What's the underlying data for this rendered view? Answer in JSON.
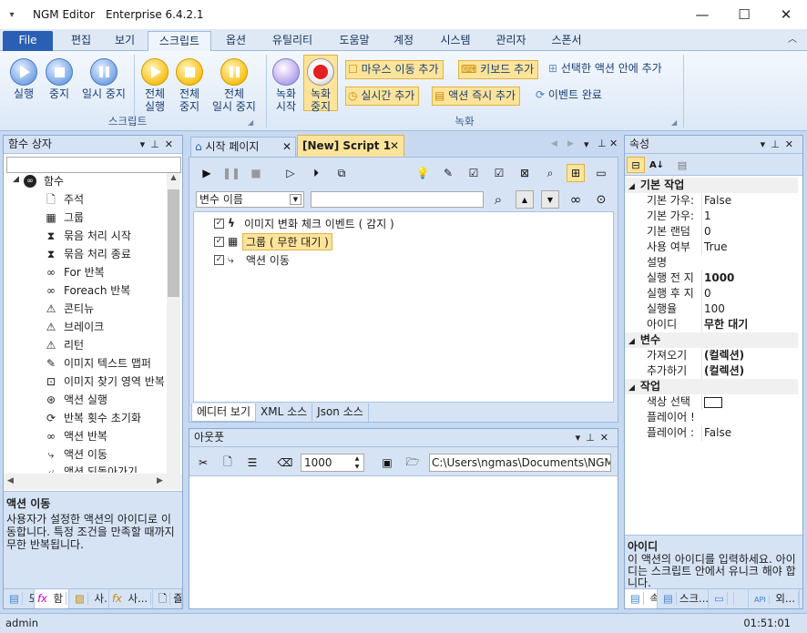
{
  "window": {
    "app_title": "NGM Editor",
    "edition": "Enterprise 6.4.2.1",
    "minimize": "—",
    "maximize": "☐",
    "close": "✕"
  },
  "menu": {
    "file": "File",
    "tabs": [
      "편집",
      "보기",
      "스크립트",
      "옵션",
      "유틸리티",
      "도움말",
      "계정",
      "시스템",
      "관리자",
      "스폰서"
    ],
    "active_tab": "스크립트"
  },
  "ribbon": {
    "script_group": "스크립트",
    "record_group": "녹화",
    "run": "실행",
    "stop": "중지",
    "pause": "일시 중지",
    "run_all_1": "전체",
    "run_all_2": "실행",
    "stop_all_1": "전체",
    "stop_all_2": "중지",
    "pause_all_1": "전체",
    "pause_all_2": "일시 중지",
    "rec_start_1": "녹화",
    "rec_start_2": "시작",
    "rec_stop_1": "녹화",
    "rec_stop_2": "중지",
    "add_mouse": "마우스 이동 추가",
    "add_keyboard": "키보드 추가",
    "add_in_selected": "선택한 액션 안에 추가",
    "add_realtime": "실시간 추가",
    "add_action_now": "액션 즉시 추가",
    "event_done": "이벤트 완료"
  },
  "function_box": {
    "title": "함수 상자",
    "root": "함수",
    "items": [
      {
        "icon": "document-icon",
        "label": "주석"
      },
      {
        "icon": "group-icon",
        "label": "그룹"
      },
      {
        "icon": "batch-start-icon",
        "label": "묶음 처리 시작"
      },
      {
        "icon": "batch-end-icon",
        "label": "묶음 처리 종료"
      },
      {
        "icon": "infinity-icon",
        "label": "For 반복"
      },
      {
        "icon": "infinity-icon",
        "label": "Foreach 반복"
      },
      {
        "icon": "continue-icon",
        "label": "콘티뉴"
      },
      {
        "icon": "break-icon",
        "label": "브레이크"
      },
      {
        "icon": "return-icon",
        "label": "리턴"
      },
      {
        "icon": "image-text-icon",
        "label": "이미지 텍스트 맵퍼"
      },
      {
        "icon": "image-search-icon",
        "label": "이미지 찾기 영역 반복"
      },
      {
        "icon": "action-run-icon",
        "label": "액션 실행"
      },
      {
        "icon": "refresh-icon",
        "label": "반복 횟수 초기화"
      },
      {
        "icon": "loop-icon",
        "label": "액션 반복"
      },
      {
        "icon": "move-icon",
        "label": "액션 이동"
      },
      {
        "icon": "back-icon",
        "label": "액션 되돌아가기"
      }
    ],
    "desc_title": "액션 이동",
    "desc_text": "사용자가 설정한 액션의 아이디로 이동합니다. 특정 조건을 만족할 때까지 무한 반복됩니다.",
    "bottom_tabs": [
      "도",
      "함",
      "사...",
      "사...",
      "즐"
    ]
  },
  "editor": {
    "tabs": [
      {
        "label": "시작 페이지"
      },
      {
        "label": "[New] Script 1"
      }
    ],
    "search_dropdown": "변수 이름",
    "search_value": "",
    "items": [
      {
        "icon": "lightning-icon",
        "label": "이미지 변화 체크 이벤트 ( 감지 )",
        "checked": true
      },
      {
        "icon": "group-icon",
        "label": "그룹 ( 무한 대기 )",
        "checked": true
      },
      {
        "icon": "move-icon",
        "label": "액션 이동",
        "checked": true
      }
    ],
    "view_tabs": [
      "에디터 보기",
      "XML 소스",
      "Json 소스"
    ]
  },
  "output": {
    "title": "아웃풋",
    "count": "1000",
    "path": "C:\\Users\\ngmas\\Documents\\NGM6\\"
  },
  "properties": {
    "title": "속성",
    "categories": [
      {
        "name": "기본 작업",
        "rows": [
          {
            "k": "기본 가우:",
            "v": "False"
          },
          {
            "k": "기본 가우:",
            "v": "1"
          },
          {
            "k": "기본 랜덤",
            "v": "0"
          },
          {
            "k": "사용 여부",
            "v": "True"
          },
          {
            "k": "설명",
            "v": ""
          },
          {
            "k": "실행 전 지",
            "v": "1000"
          },
          {
            "k": "실행 후 지",
            "v": "0"
          },
          {
            "k": "실행율",
            "v": "100"
          },
          {
            "k": "아이디",
            "v": "무한 대기"
          }
        ]
      },
      {
        "name": "변수",
        "rows": [
          {
            "k": "가져오기",
            "v": "(컬렉션)"
          },
          {
            "k": "추가하기",
            "v": "(컬렉션)"
          }
        ]
      },
      {
        "name": "작업",
        "rows": [
          {
            "k": "색상 선택",
            "v": ""
          },
          {
            "k": "플레이어 !",
            "v": ""
          },
          {
            "k": "플레이어 :",
            "v": "False"
          }
        ]
      }
    ],
    "desc_title": "아이디",
    "desc_text": "이 액션의 아이디를 입력하세요. 아이디는 스크립트 안에서 유니크 해야 합니다.",
    "bottom_tabs": [
      "속",
      "스크...",
      "",
      "외..."
    ]
  },
  "status": {
    "user": "admin",
    "time": "01:51:01"
  },
  "colors": {
    "accent": "#2b5fb4",
    "highlight": "#fde49a",
    "panel_header": "#d6e3f4"
  }
}
